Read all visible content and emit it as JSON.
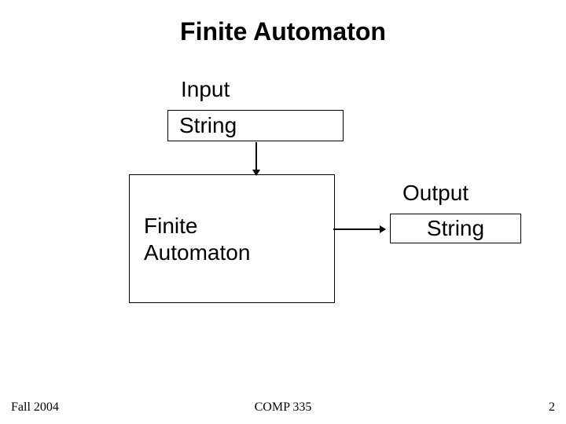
{
  "title": "Finite Automaton",
  "input_label": "Input",
  "input_value": "String",
  "automaton_label": "Finite\nAutomaton",
  "output_label": "Output",
  "output_value": "String",
  "footer": {
    "left": "Fall 2004",
    "center": "COMP 335",
    "right": "2"
  }
}
